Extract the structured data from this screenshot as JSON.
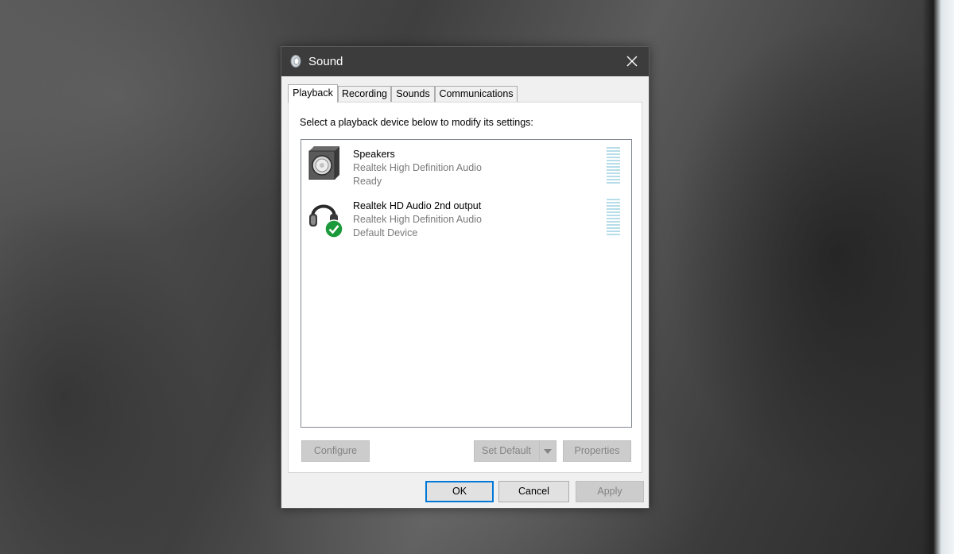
{
  "window": {
    "title": "Sound",
    "close_symbol": "✕"
  },
  "tabs": [
    {
      "label": "Playback",
      "active": true
    },
    {
      "label": "Recording",
      "active": false
    },
    {
      "label": "Sounds",
      "active": false
    },
    {
      "label": "Communications",
      "active": false
    }
  ],
  "playback": {
    "instructions": "Select a playback device below to modify its settings:",
    "devices": [
      {
        "name": "Speakers",
        "driver": "Realtek High Definition Audio",
        "status": "Ready",
        "icon": "speaker-icon"
      },
      {
        "name": "Realtek HD Audio 2nd output",
        "driver": "Realtek High Definition Audio",
        "status": "Default Device",
        "icon": "headphones-icon",
        "badge": "default-check-icon"
      }
    ],
    "buttons": {
      "configure": "Configure",
      "set_default": "Set Default",
      "properties": "Properties"
    }
  },
  "footer": {
    "ok": "OK",
    "cancel": "Cancel",
    "apply": "Apply"
  },
  "colors": {
    "titlebar": "#3c3c3c",
    "focus_accent": "#0078d7",
    "meter": "#b6dde9",
    "default_badge": "#1a9a3a"
  }
}
